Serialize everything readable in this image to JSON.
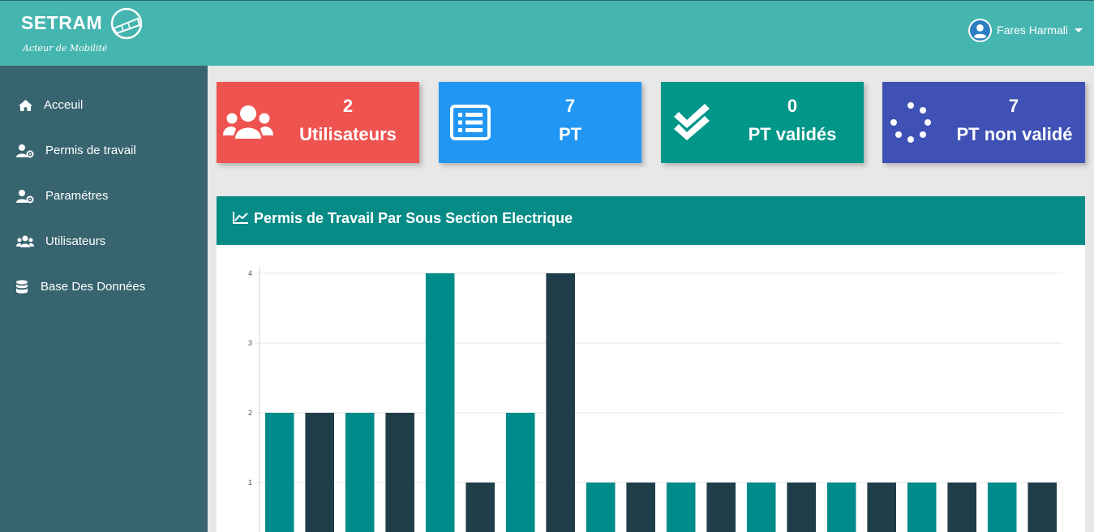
{
  "header": {
    "brand_name": "SETRAM",
    "brand_tagline": "Acteur de Mobilité",
    "user_name": "Fares Harmali"
  },
  "sidebar": {
    "items": [
      {
        "label": "Acceuil",
        "icon": "home-icon"
      },
      {
        "label": "Permis de travail",
        "icon": "user-cog-icon"
      },
      {
        "label": "Paramétres",
        "icon": "user-cog-icon"
      },
      {
        "label": "Utilisateurs",
        "icon": "users-icon"
      },
      {
        "label": "Base Des Données",
        "icon": "database-icon"
      }
    ]
  },
  "stats": [
    {
      "value": "2",
      "label": "Utilisateurs",
      "icon": "users-icon",
      "color": "#ef5350"
    },
    {
      "value": "7",
      "label": "PT",
      "icon": "list-icon",
      "color": "#2196f3"
    },
    {
      "value": "0",
      "label": "PT validés",
      "icon": "double-check-icon",
      "color": "#009688"
    },
    {
      "value": "7",
      "label": "PT non validé",
      "icon": "spinner-icon",
      "color": "#3f51b5"
    }
  ],
  "chart_panel": {
    "title": "Permis de Travail Par Sous Section Electrique",
    "icon": "line-chart-icon"
  },
  "chart_data": {
    "type": "bar",
    "title": "Permis de Travail Par Sous Section Electrique",
    "xlabel": "",
    "ylabel": "",
    "ylim": [
      0,
      4
    ],
    "y_ticks": [
      "1",
      "2",
      "3",
      "4"
    ],
    "grid": true,
    "values": [
      2,
      2,
      2,
      2,
      4,
      1,
      2,
      4,
      1,
      1,
      1,
      1,
      1,
      1,
      1,
      1,
      1,
      1,
      1,
      1
    ],
    "colors": [
      "#008b8b",
      "#203e4a"
    ]
  },
  "colors": {
    "header": "#45b5b0",
    "sidebar": "#386470",
    "panel_header": "#078b87"
  }
}
